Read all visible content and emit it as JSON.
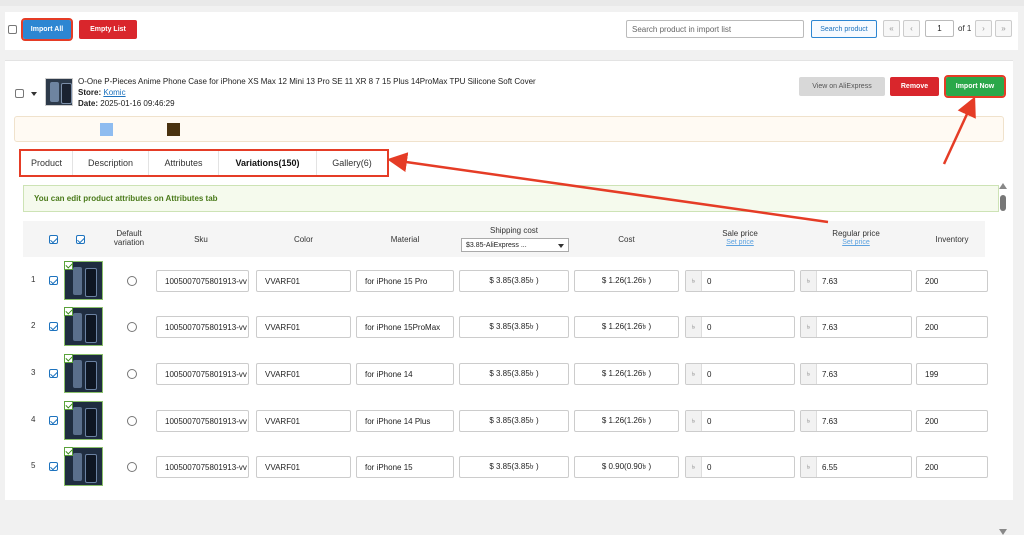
{
  "header": {
    "import_all_label": "Import All",
    "empty_list_label": "Empty List",
    "search_placeholder": "Search product in import list",
    "search_button_label": "Search product",
    "page_value": "1",
    "page_of": "of 1",
    "first_glyph": "«",
    "prev_glyph": "‹",
    "next_glyph": "›",
    "last_glyph": "»"
  },
  "product": {
    "title": "O-One P-Pieces Anime Phone Case for iPhone XS Max 12 Mini 13 Pro SE 11 XR 8 7 15 Plus 14ProMax TPU Silicone Soft Cover",
    "store_label": "Store:",
    "store_name": "Komic",
    "date_label": "Date:",
    "date_value": "2025-01-16 09:46:29",
    "view_button": "View on AliExpress",
    "remove_button": "Remove",
    "import_button": "Import Now",
    "swatch_colors": [
      "#8fbcf0",
      "#4a3210"
    ]
  },
  "tabs": [
    "Product",
    "Description",
    "Attributes",
    "Variations(150)",
    "Gallery(6)"
  ],
  "info_message": "You can edit product attributes on Attributes tab",
  "table": {
    "headers": {
      "default_variation": "Default variation",
      "sku": "Sku",
      "color": "Color",
      "material": "Material",
      "shipping_cost": "Shipping cost",
      "shipping_select": "$3.85-AliExpress ...",
      "cost": "Cost",
      "sale_price": "Sale price",
      "regular_price": "Regular price",
      "set_price": "Set price",
      "inventory": "Inventory"
    },
    "currency_prefix": "৳",
    "rows": [
      {
        "num": "1",
        "sku": "1005007075801913-vv",
        "color": "VVARF01",
        "material": "for iPhone 15 Pro",
        "shipping": "$ 3.85(3.85৳ )",
        "cost": "$ 1.26(1.26৳ )",
        "sale": "0",
        "regular": "7.63",
        "inventory": "200"
      },
      {
        "num": "2",
        "sku": "1005007075801913-vv",
        "color": "VVARF01",
        "material": "for iPhone 15ProMax",
        "shipping": "$ 3.85(3.85৳ )",
        "cost": "$ 1.26(1.26৳ )",
        "sale": "0",
        "regular": "7.63",
        "inventory": "200"
      },
      {
        "num": "3",
        "sku": "1005007075801913-vv",
        "color": "VVARF01",
        "material": "for iPhone 14",
        "shipping": "$ 3.85(3.85৳ )",
        "cost": "$ 1.26(1.26৳ )",
        "sale": "0",
        "regular": "7.63",
        "inventory": "199"
      },
      {
        "num": "4",
        "sku": "1005007075801913-vv",
        "color": "VVARF01",
        "material": "for iPhone 14 Plus",
        "shipping": "$ 3.85(3.85৳ )",
        "cost": "$ 1.26(1.26৳ )",
        "sale": "0",
        "regular": "7.63",
        "inventory": "200"
      },
      {
        "num": "5",
        "sku": "1005007075801913-vv",
        "color": "VVARF01",
        "material": "for iPhone 15",
        "shipping": "$ 3.85(3.85৳ )",
        "cost": "$ 0.90(0.90৳ )",
        "sale": "0",
        "regular": "6.55",
        "inventory": "200"
      }
    ]
  },
  "colors": {
    "accent_blue": "#2d86d2",
    "danger_red": "#d9262c",
    "success_green": "#2aa84a",
    "annotation_red": "#e53c26"
  }
}
